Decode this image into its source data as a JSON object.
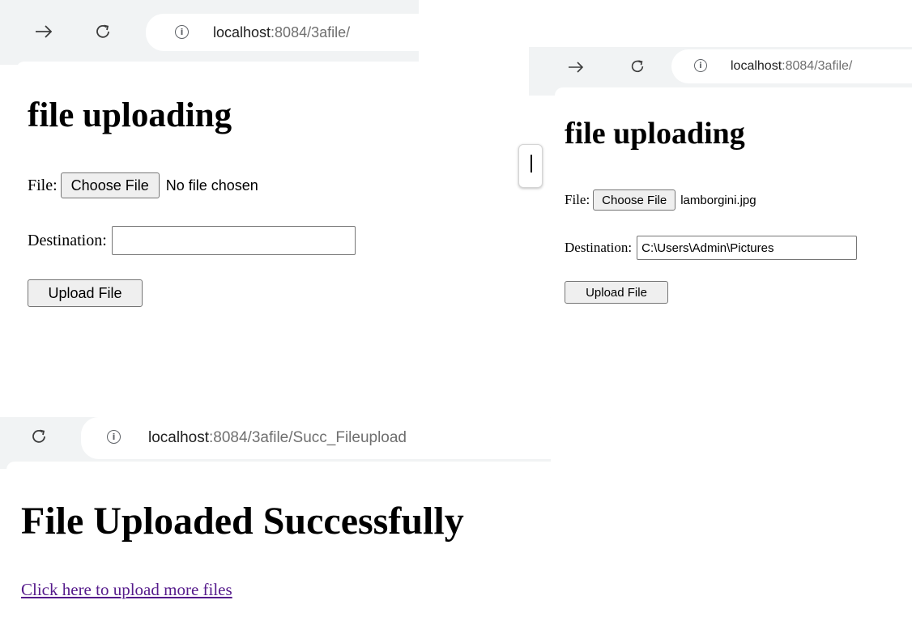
{
  "screen1": {
    "url_host": "localhost",
    "url_path": ":8084/3afile/",
    "heading": "file uploading",
    "file_label": "File:",
    "choose_button": "Choose File",
    "file_status": "No file chosen",
    "destination_label": "Destination:",
    "destination_value": "",
    "upload_button": "Upload File"
  },
  "screen2": {
    "url_host": "localhost",
    "url_path": ":8084/3afile/",
    "heading": "file uploading",
    "file_label": "File:",
    "choose_button": "Choose File",
    "file_status": "lamborgini.jpg",
    "destination_label": "Destination:",
    "destination_value": "C:\\Users\\Admin\\Pictures",
    "upload_button": "Upload File"
  },
  "screen3": {
    "url_host": "localhost",
    "url_path": ":8084/3afile/Succ_Fileupload",
    "heading": "File Uploaded Successfully",
    "link_text": "Click here to upload more files"
  },
  "icons": {
    "forward": "forward-arrow-icon",
    "reload": "reload-icon",
    "info": "info-icon"
  },
  "colors": {
    "chrome_bar": "#f1f3f4",
    "visited_link": "#551a8b",
    "button_bg": "#efefef"
  }
}
